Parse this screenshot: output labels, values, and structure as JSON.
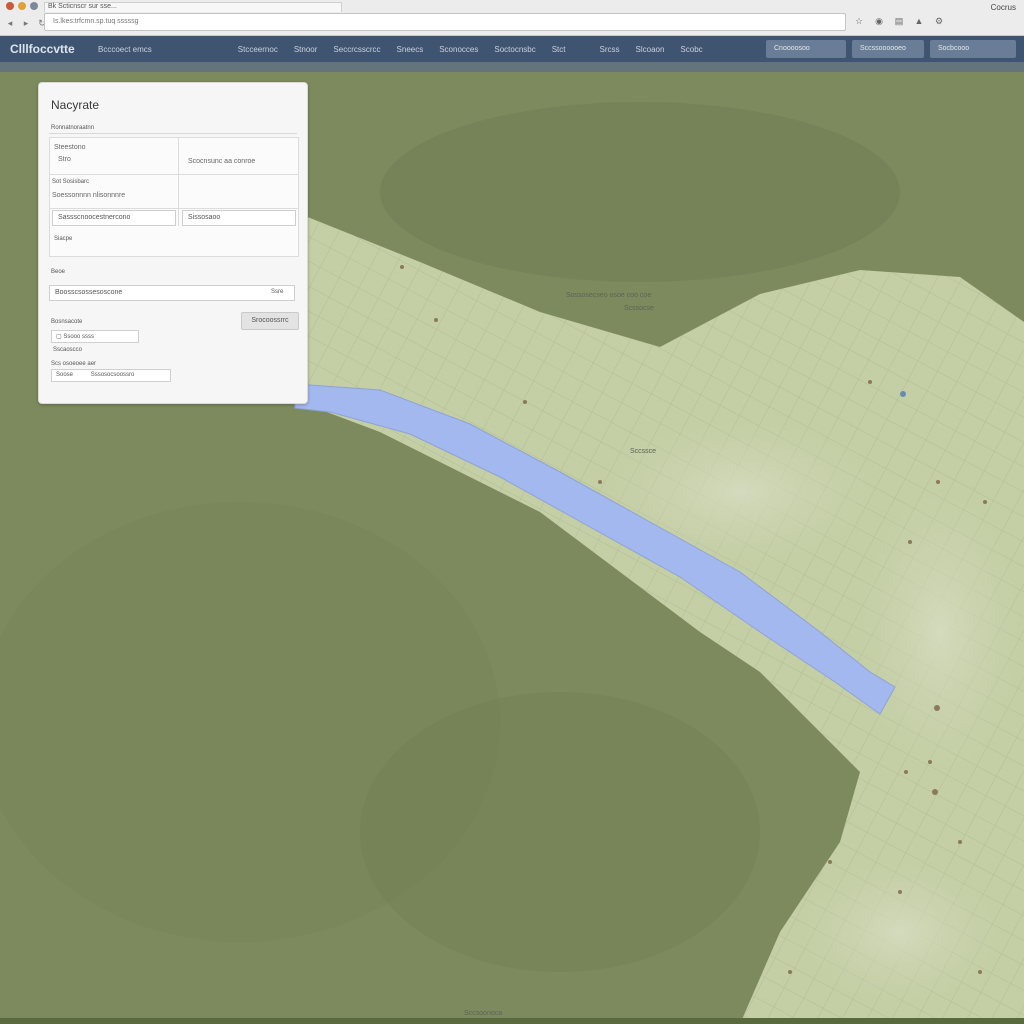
{
  "browser": {
    "tab_title": "Bk Scticnscr sur sse...",
    "address": "Is.lkes:trfcmn.sp.tuq sssssg",
    "top_right": "Cocrus",
    "tab_colors": [
      "#c85a3a",
      "#e0a03a",
      "#7a8a9a"
    ]
  },
  "app": {
    "logo": "Clllfoccvtte",
    "brand_sub": "Bcccoect emcs",
    "nav": [
      "Stcceernoc",
      "Stnoor",
      "Seccrcsscrcc",
      "Sneecs",
      "Sconocces",
      "Soctocnsbc",
      "Stct"
    ],
    "nav_right": [
      "Srcss",
      "Slcoaon",
      "Scobc"
    ],
    "field_a": "Cnoooosoo",
    "field_b": "Sccssoooooeo",
    "field_c": "Socbcooo"
  },
  "panel": {
    "title": "Nacyrate",
    "section_label": "Ronnatnoraatnn",
    "cell_a_label": "Steestono",
    "cell_a_value": "Stro",
    "cell_b_value": "Scocnsunc aa conroe",
    "row2_label": "Sot Sosisbarc",
    "row2_value": "Soessonnnn nlisonnnre",
    "input_a": "Sassscnoocestnercono",
    "input_b": "Sissosaoo",
    "caption_a": "Siacpe",
    "section2_label": "Beoe",
    "search_value": "Boosscsossesoscone",
    "search_action": "Ssre",
    "section3_label": "Bosnsacote",
    "apply_button": "Srocoossrrc",
    "checkbox_label": "Ssooo ssss",
    "meta_label": "Sscaoscco",
    "coords_label": "Scs osoeoee aer",
    "range_a": "Soose",
    "range_b": "Sssosocsoossro"
  },
  "map": {
    "label_1": "Sossosecseo osoe coo coe",
    "label_2": "Scssocse",
    "label_3": "Sccssce",
    "footer_label": "Sccsoonoca"
  },
  "colors": {
    "terrain": "#7d8a5e",
    "city": "#c5cfa6",
    "river": "#a3b8ee",
    "header": "#3f5470"
  }
}
